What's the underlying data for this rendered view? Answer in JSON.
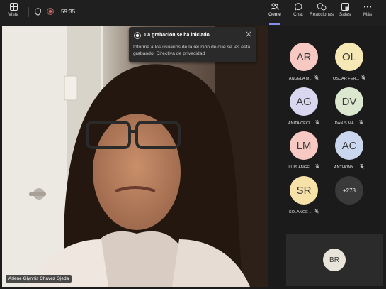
{
  "toolbar": {
    "view_label": "Vista",
    "timer": "59:35",
    "people_label": "Gente",
    "chat_label": "Chat",
    "reactions_label": "Reacciones",
    "rooms_label": "Salas",
    "more_label": "Más"
  },
  "notification": {
    "title": "La grabación se ha iniciado",
    "body": "Informa a los usuarios de la reunión de que se les está grabando. Directiva de privacidad"
  },
  "video": {
    "speaker_name": "Arlene Glynnis Chavez Ojeda"
  },
  "participants": [
    {
      "initials": "AR",
      "name": "ANGELA M...",
      "color": "#f7c9c2"
    },
    {
      "initials": "OL",
      "name": "OSCAR FER...",
      "color": "#f6e8b4"
    },
    {
      "initials": "AG",
      "name": "ANITA CECI...",
      "color": "#d9d6f0"
    },
    {
      "initials": "DV",
      "name": "DANIS MA...",
      "color": "#dbe8cf"
    },
    {
      "initials": "LM",
      "name": "LUIS ANGE...",
      "color": "#f7c9c2"
    },
    {
      "initials": "AC",
      "name": "ANTHONY ...",
      "color": "#c9d6ee"
    },
    {
      "initials": "SR",
      "name": "SOLANGE ...",
      "color": "#f6e1a8"
    }
  ],
  "more_participants": "+273",
  "self_view": {
    "initials": "BR"
  }
}
